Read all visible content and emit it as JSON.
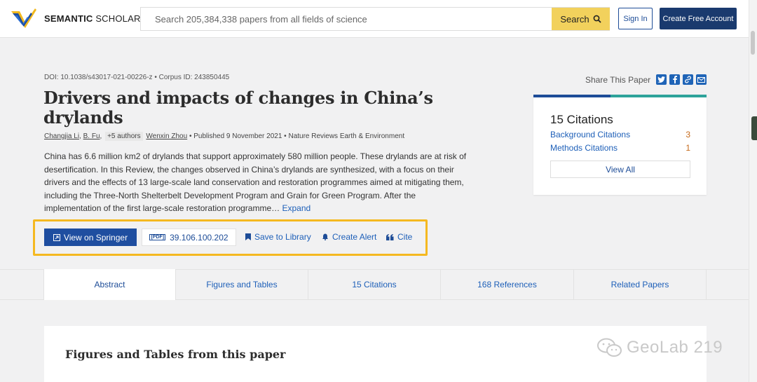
{
  "header": {
    "brand_bold": "SEMANTIC",
    "brand_light": "SCHOLAR",
    "search_placeholder": "Search 205,384,338 papers from all fields of science",
    "search_button": "Search",
    "sign_in": "Sign In",
    "create_account": "Create Free Account"
  },
  "paper": {
    "doi_line": "DOI: 10.1038/s43017-021-00226-z  •  Corpus ID: 243850445",
    "title": "Drivers and impacts of changes in China’s drylands",
    "authors": {
      "author1": "Changjia Li",
      "author2": "B. Fu",
      "more": "+5 authors",
      "author_last": "Wenxin Zhou",
      "published": "•  Published 9 November 2021  •  Nature Reviews Earth & Environment"
    },
    "abstract": "China has 6.6 million km2 of drylands that support approximately 580 million people. These drylands are at risk of desertification. In this Review, the changes observed in China’s drylands are synthesized, with a focus on their drivers and the effects of 13 large-scale land conservation and restoration programmes aimed at mitigating them, including the Three-North Shelterbelt Development Program and Grain for Green Program. After the implementation of the first large-scale restoration programme…",
    "expand": "Expand"
  },
  "actions": {
    "view_springer": "View on Springer",
    "pdf_tag": "[PDF]",
    "pdf_label": "39.106.100.202",
    "save_library": "Save to Library",
    "create_alert": "Create Alert",
    "cite": "Cite"
  },
  "share": {
    "label": "Share This Paper",
    "icons": [
      "twitter-icon",
      "facebook-icon",
      "link-icon",
      "email-icon"
    ]
  },
  "citations": {
    "count_label": "15 Citations",
    "background_label": "Background Citations",
    "background_count": "3",
    "methods_label": "Methods Citations",
    "methods_count": "1",
    "view_all": "View All"
  },
  "tabs": [
    "Abstract",
    "Figures and Tables",
    "15 Citations",
    "168 References",
    "Related Papers"
  ],
  "figures": {
    "title": "Figures and Tables from this paper"
  },
  "watermark": "GeoLab 219",
  "colors": {
    "primary": "#1d4c97",
    "search_button": "#f2d15c",
    "highlight": "#f5b921",
    "accent_teal": "#2ea39a",
    "count_orange": "#c56a1a"
  }
}
